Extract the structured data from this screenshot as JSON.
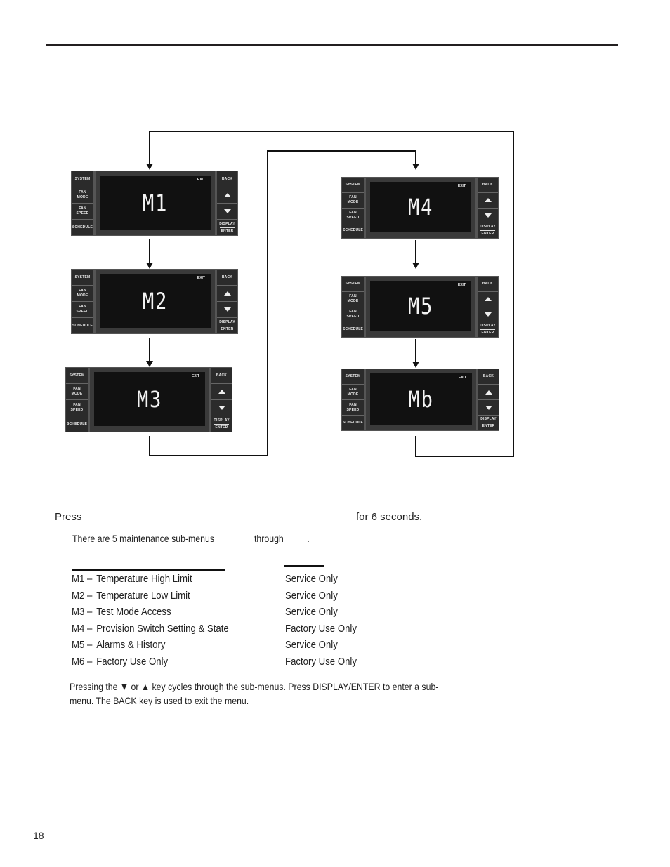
{
  "header": {
    "rule": "top-divider"
  },
  "panels": [
    {
      "id": "m1",
      "display": "M1",
      "exit": "EXIT",
      "left_keys": [
        "SYSTEM",
        "FAN\nMODE",
        "FAN\nSPEED",
        "SCHEDULE"
      ],
      "right_keys": {
        "back": "BACK",
        "display": "DISPLAY",
        "enter": "ENTER"
      }
    },
    {
      "id": "m2",
      "display": "M2",
      "exit": "EXIT",
      "left_keys": [
        "SYSTEM",
        "FAN\nMODE",
        "FAN\nSPEED",
        "SCHEDULE"
      ],
      "right_keys": {
        "back": "BACK",
        "display": "DISPLAY",
        "enter": "ENTER"
      }
    },
    {
      "id": "m3",
      "display": "M3",
      "exit": "EXIT",
      "left_keys": [
        "SYSTEM",
        "FAN\nMODE",
        "FAN\nSPEED",
        "SCHEDULE"
      ],
      "right_keys": {
        "back": "BACK",
        "display": "DISPLAY",
        "enter": "ENTER"
      }
    },
    {
      "id": "m4",
      "display": "M4",
      "exit": "EXIT",
      "left_keys": [
        "SYSTEM",
        "FAN\nMODE",
        "FAN\nSPEED",
        "SCHEDULE"
      ],
      "right_keys": {
        "back": "BACK",
        "display": "DISPLAY",
        "enter": "ENTER"
      }
    },
    {
      "id": "m5",
      "display": "M5",
      "exit": "EXIT",
      "left_keys": [
        "SYSTEM",
        "FAN\nMODE",
        "FAN\nSPEED",
        "SCHEDULE"
      ],
      "right_keys": {
        "back": "BACK",
        "display": "DISPLAY",
        "enter": "ENTER"
      }
    },
    {
      "id": "m6",
      "display": "Mb",
      "exit": "EXIT",
      "left_keys": [
        "SYSTEM",
        "FAN\nMODE",
        "FAN\nSPEED",
        "SCHEDULE"
      ],
      "right_keys": {
        "back": "BACK",
        "display": "DISPLAY",
        "enter": "ENTER"
      }
    }
  ],
  "instructions": {
    "press": "Press",
    "for_seconds": "for 6 seconds.",
    "there_are": "There are 5 maintenance sub-menus",
    "through": "through",
    "period": "."
  },
  "menu_items": [
    {
      "code": "M1 –",
      "name": "Temperature High Limit",
      "access": "Service Only"
    },
    {
      "code": "M2 –",
      "name": "Temperature Low Limit",
      "access": "Service Only"
    },
    {
      "code": "M3 –",
      "name": "Test Mode Access",
      "access": "Service Only"
    },
    {
      "code": "M4 –",
      "name": "Provision Switch Setting & State",
      "access": "Factory Use Only"
    },
    {
      "code": "M5 –",
      "name": "Alarms & History",
      "access": "Service Only"
    },
    {
      "code": "M6 –",
      "name": "Factory Use Only",
      "access": "Factory Use Only"
    }
  ],
  "note": "Pressing the ▼ or ▲ key cycles through the sub-menus. Press DISPLAY/ENTER to enter a sub-menu. The BACK key is used to exit the menu.",
  "page_number": "18"
}
